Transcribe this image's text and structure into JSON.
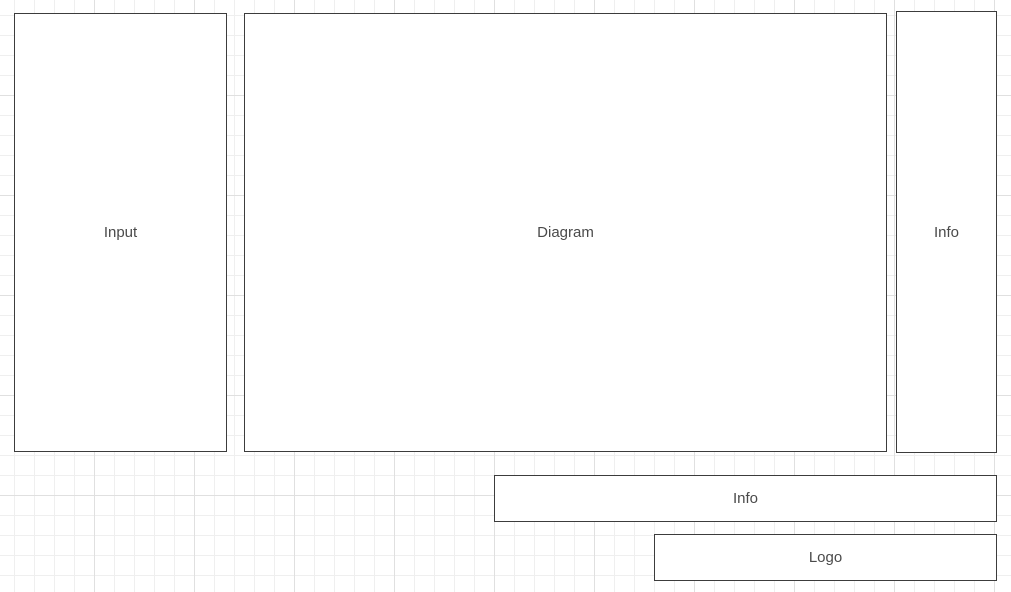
{
  "boxes": {
    "input": {
      "label": "Input"
    },
    "diagram": {
      "label": "Diagram"
    },
    "info_side": {
      "label": "Info"
    },
    "info_bottom": {
      "label": "Info"
    },
    "logo": {
      "label": "Logo"
    }
  }
}
